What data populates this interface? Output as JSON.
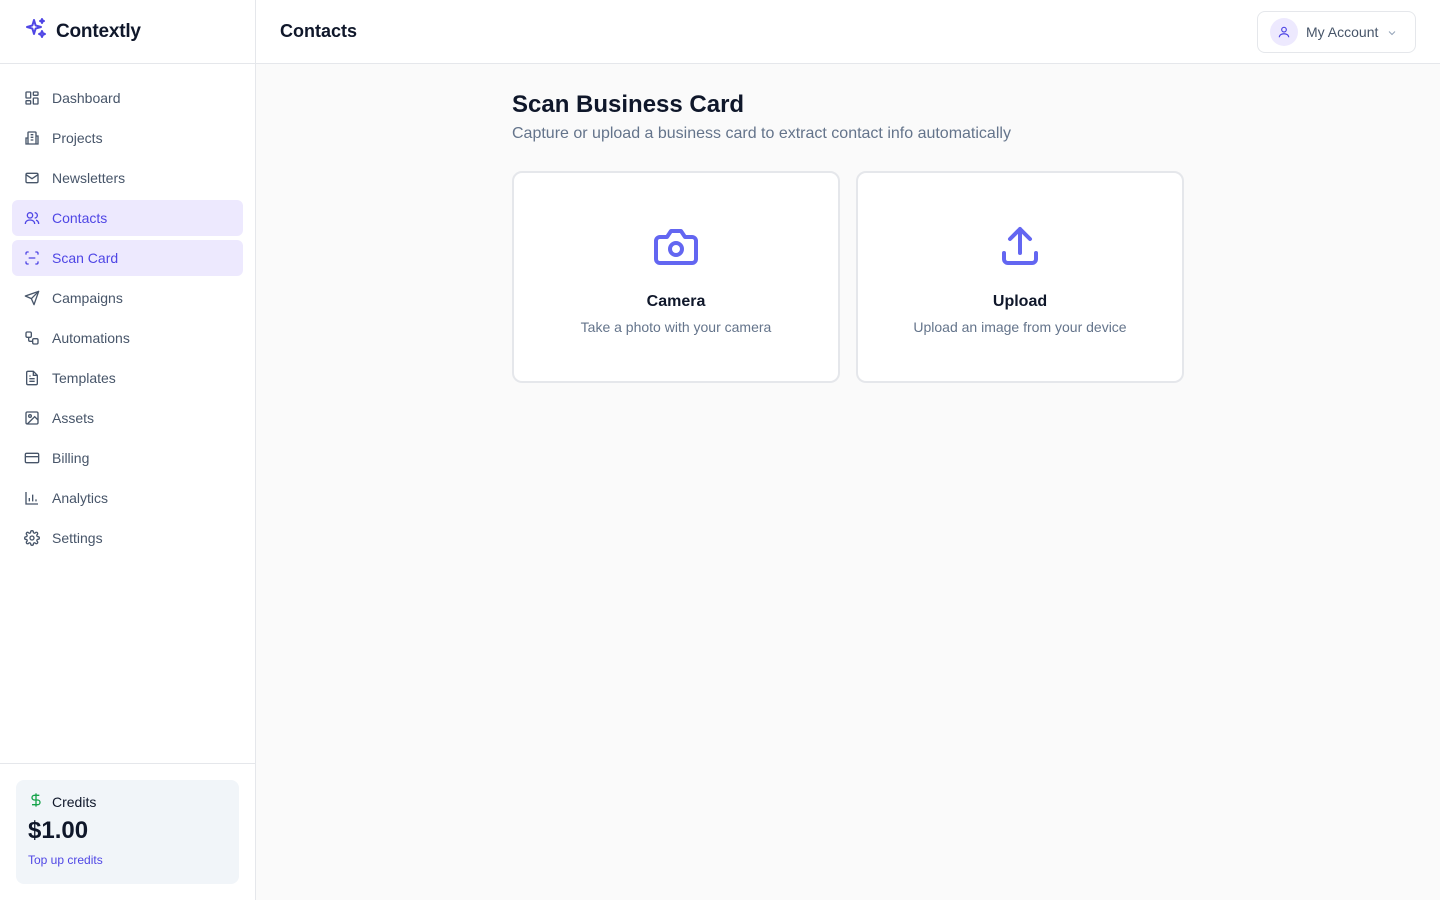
{
  "app": {
    "name": "Contextly"
  },
  "sidebar": {
    "items": [
      {
        "label": "Dashboard",
        "icon": "layout-grid-icon",
        "active": false
      },
      {
        "label": "Projects",
        "icon": "building-icon",
        "active": false
      },
      {
        "label": "Newsletters",
        "icon": "mail-icon",
        "active": false
      },
      {
        "label": "Contacts",
        "icon": "users-icon",
        "active": true
      },
      {
        "label": "Scan Card",
        "icon": "scan-icon",
        "active": true
      },
      {
        "label": "Campaigns",
        "icon": "send-icon",
        "active": false
      },
      {
        "label": "Automations",
        "icon": "workflow-icon",
        "active": false
      },
      {
        "label": "Templates",
        "icon": "file-text-icon",
        "active": false
      },
      {
        "label": "Assets",
        "icon": "image-icon",
        "active": false
      },
      {
        "label": "Billing",
        "icon": "credit-card-icon",
        "active": false
      },
      {
        "label": "Analytics",
        "icon": "bar-chart-icon",
        "active": false
      },
      {
        "label": "Settings",
        "icon": "gear-icon",
        "active": false
      }
    ]
  },
  "credits": {
    "label": "Credits",
    "amount": "$1.00",
    "link": "Top up credits"
  },
  "header": {
    "title": "Contacts",
    "account_label": "My Account"
  },
  "main": {
    "title": "Scan Business Card",
    "subtitle": "Capture or upload a business card to extract contact info automatically",
    "options": [
      {
        "title": "Camera",
        "description": "Take a photo with your camera",
        "icon": "camera-icon"
      },
      {
        "title": "Upload",
        "description": "Upload an image from your device",
        "icon": "upload-icon"
      }
    ]
  },
  "colors": {
    "accent": "#4f46e5",
    "accent_icon": "#6366f1",
    "active_bg": "#ede9fe",
    "credits_icon": "#16a34a",
    "text_muted": "#64748b"
  }
}
